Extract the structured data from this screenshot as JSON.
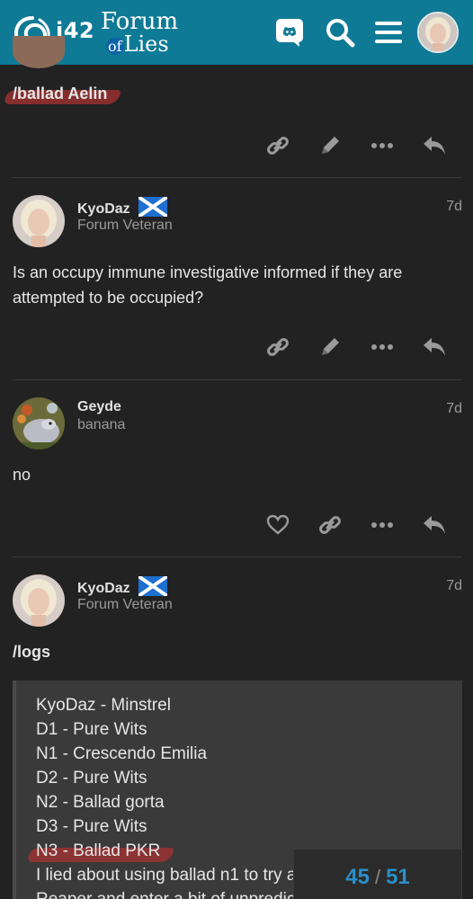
{
  "header": {
    "logo_text": "i42",
    "site_title_line1": "Forum",
    "site_title_of": "of",
    "site_title_line2": "Lies"
  },
  "icons": {
    "discord": "discord-icon",
    "search": "search-icon",
    "menu": "hamburger-menu-icon",
    "link": "link-icon",
    "edit": "pencil-icon",
    "more": "ellipsis-icon",
    "reply": "reply-icon",
    "like": "heart-icon"
  },
  "colors": {
    "header_bg": "#0f7a96",
    "page_bg": "#222222",
    "accent": "#2a8fc8",
    "highlight": "#a83232"
  },
  "posts": [
    {
      "body": "/ballad Aelin"
    },
    {
      "username": "KyoDaz",
      "title": "Forum Veteran",
      "age": "7d",
      "body": "Is an occupy immune investigative informed if they are attempted to be occupied?"
    },
    {
      "username": "Geyde",
      "title": "banana",
      "age": "7d",
      "body": "no"
    },
    {
      "username": "KyoDaz",
      "title": "Forum Veteran",
      "age": "7d",
      "body": "/logs",
      "quote": [
        "KyoDaz - Minstrel",
        "D1 - Pure Wits",
        "N1 - Crescendo Emilia",
        "D2 - Pure Wits",
        "N2 - Ballad gorta",
        "D3 - Pure Wits",
        "N3 - Ballad PKR",
        "I lied about using ballad n1 to try a",
        "Reaper and enter a bit of unpredic"
      ]
    }
  ],
  "progress": {
    "current": "45",
    "separator": "/",
    "total": "51"
  }
}
